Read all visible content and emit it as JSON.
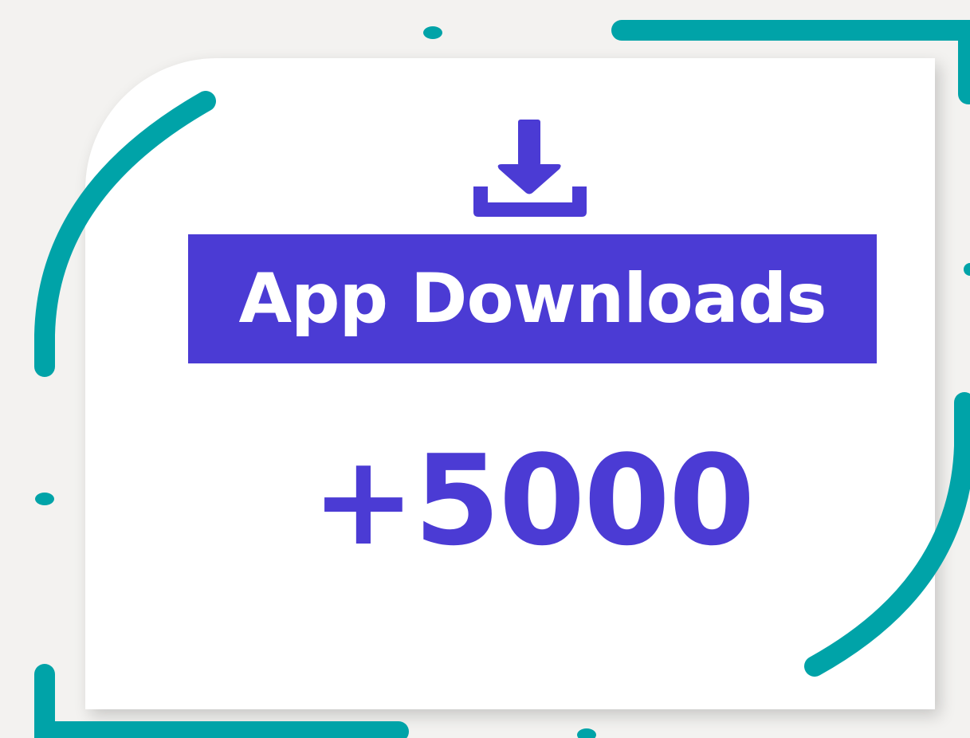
{
  "stat": {
    "title": "App Downloads",
    "count": "+5000",
    "icon": "download-icon"
  },
  "colors": {
    "accent": "#4b3bd4",
    "decor": "#00a3a8",
    "background": "#f3f2f0",
    "card": "#ffffff"
  }
}
